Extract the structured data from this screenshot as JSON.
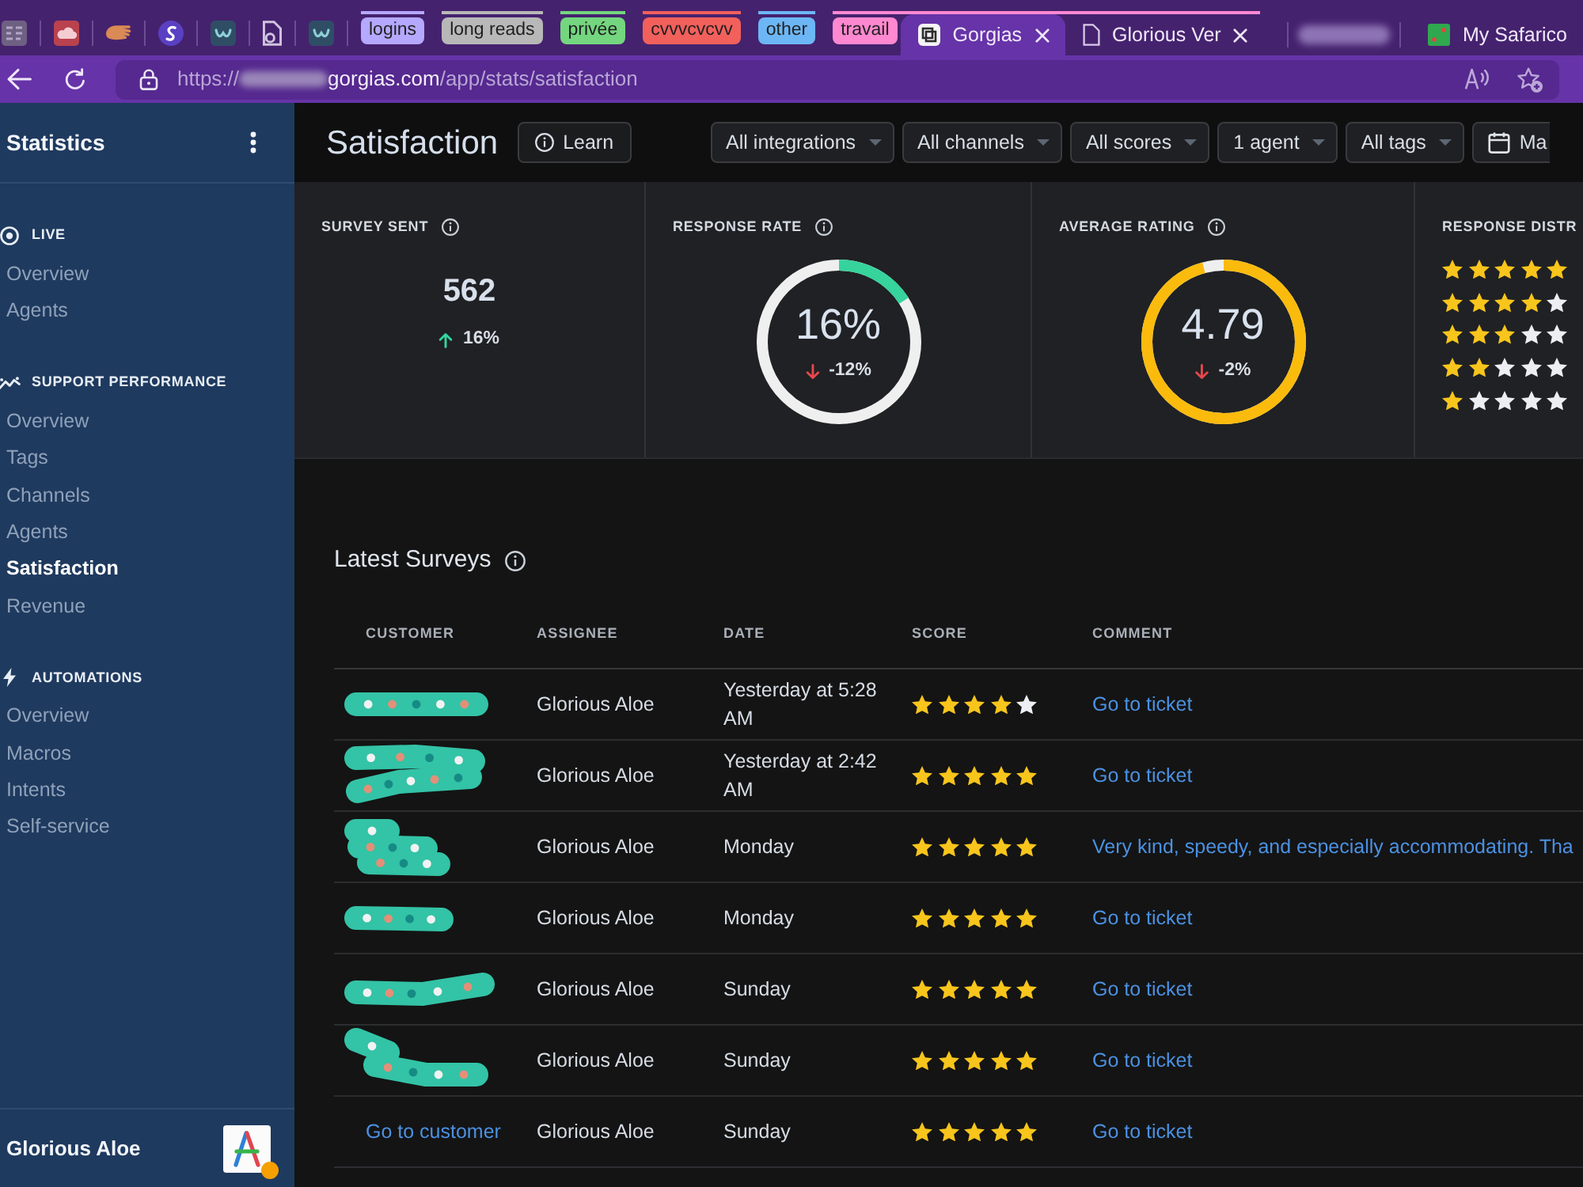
{
  "browser": {
    "pinned_tabs": [
      {
        "kind": "grid"
      },
      {
        "kind": "cloud"
      },
      {
        "kind": "hand"
      },
      {
        "kind": "swirl"
      },
      {
        "kind": "tile"
      },
      {
        "kind": "document"
      },
      {
        "kind": "tile"
      }
    ],
    "tab_groups": [
      {
        "label": "logins",
        "color": "#b5a8ff"
      },
      {
        "label": "long reads",
        "color": "#b8b8b8"
      },
      {
        "label": "privée",
        "color": "#74d67f"
      },
      {
        "label": "cvvvcvcvv",
        "color": "#f2605c"
      },
      {
        "label": "other",
        "color": "#6db6f5"
      },
      {
        "label": "travail",
        "color": "#ff88d1",
        "tabs": [
          {
            "kind": "framed",
            "title": "Gorgias",
            "selected": true,
            "closable": true
          },
          {
            "kind": "document",
            "title": "Glorious Ver",
            "selected": false,
            "closable": true
          }
        ]
      }
    ],
    "tabs": [
      {
        "kind": "redacted",
        "selected": false
      },
      {
        "kind": "tile",
        "title": "My Safarico",
        "selected": false,
        "closable": false
      }
    ],
    "address": [
      {
        "kind": "dim",
        "text": "https://"
      },
      {
        "kind": "blur"
      },
      {
        "kind": "bright",
        "text": "gorgias.com"
      },
      {
        "kind": "dim",
        "text": "/app/stats/satisfaction"
      }
    ]
  },
  "sidebar": {
    "title": "Statistics",
    "sections": [
      {
        "kind": "live",
        "label": "LIVE",
        "items": [
          {
            "label": "Overview",
            "selected": false
          },
          {
            "label": "Agents",
            "selected": false
          }
        ]
      },
      {
        "kind": "performance",
        "label": "SUPPORT PERFORMANCE",
        "items": [
          {
            "label": "Overview",
            "selected": false
          },
          {
            "label": "Tags",
            "selected": false
          },
          {
            "label": "Channels",
            "selected": false
          },
          {
            "label": "Agents",
            "selected": false
          },
          {
            "label": "Satisfaction",
            "selected": true
          },
          {
            "label": "Revenue",
            "selected": false
          }
        ]
      },
      {
        "kind": "automations",
        "label": "AUTOMATIONS",
        "items": [
          {
            "label": "Overview",
            "selected": false
          },
          {
            "label": "Macros",
            "selected": false
          },
          {
            "label": "Intents",
            "selected": false
          },
          {
            "label": "Self-service",
            "selected": false
          }
        ]
      }
    ],
    "user": {
      "name": "Glorious Aloe",
      "away": true
    }
  },
  "header": {
    "title": "Satisfaction",
    "learn": "Learn",
    "filters": [
      {
        "kind": "dropdown",
        "label": "All integrations"
      },
      {
        "kind": "dropdown",
        "label": "All channels"
      },
      {
        "kind": "dropdown",
        "label": "All scores"
      },
      {
        "kind": "dropdown",
        "label": "1 agent"
      },
      {
        "kind": "dropdown",
        "label": "All tags"
      },
      {
        "kind": "date",
        "label": "Ma"
      }
    ]
  },
  "stats": [
    {
      "kind": "number",
      "title": "SURVEY SENT",
      "info_icon": true,
      "value": "562",
      "rising": true,
      "delta": "16%"
    },
    {
      "kind": "ring",
      "title": "RESPONSE RATE",
      "info_icon": true,
      "value": "16%",
      "level": 0.16,
      "color": "#36d39c",
      "rising": false,
      "delta": "-12%"
    },
    {
      "kind": "ring",
      "title": "AVERAGE RATING",
      "info_icon": true,
      "value": "4.79",
      "level": 0.958,
      "color": "#fbbb0c",
      "rising": false,
      "delta": "-2%"
    },
    {
      "kind": "distribution",
      "title": "RESPONSE DISTR",
      "info_icon": false,
      "rows": [
        {
          "stars": 5
        },
        {
          "stars": 4
        },
        {
          "stars": 3
        },
        {
          "stars": 2
        },
        {
          "stars": 1
        }
      ]
    }
  ],
  "surveys": {
    "title": "Latest Surveys",
    "info_icon": true,
    "columns": [
      "CUSTOMER",
      "ASSIGNEE",
      "DATE",
      "SCORE",
      "COMMENT"
    ],
    "rows": [
      {
        "customer": {
          "kind": "scribble"
        },
        "assignee": "Glorious Aloe",
        "date": "Yesterday at 5:28 AM",
        "stars": 4,
        "comment": "Go to ticket"
      },
      {
        "customer": {
          "kind": "scribble"
        },
        "assignee": "Glorious Aloe",
        "date": "Yesterday at 2:42 AM",
        "stars": 5,
        "comment": "Go to ticket"
      },
      {
        "customer": {
          "kind": "scribble"
        },
        "assignee": "Glorious Aloe",
        "date": "Monday",
        "stars": 5,
        "comment": "Very kind, speedy, and especially accommodating. Tha"
      },
      {
        "customer": {
          "kind": "scribble"
        },
        "assignee": "Glorious Aloe",
        "date": "Monday",
        "stars": 5,
        "comment": "Go to ticket"
      },
      {
        "customer": {
          "kind": "scribble"
        },
        "assignee": "Glorious Aloe",
        "date": "Sunday",
        "stars": 5,
        "comment": "Go to ticket"
      },
      {
        "customer": {
          "kind": "scribble"
        },
        "assignee": "Glorious Aloe",
        "date": "Sunday",
        "stars": 5,
        "comment": "Go to ticket"
      },
      {
        "customer": {
          "kind": "link",
          "text": "Go to customer"
        },
        "assignee": "Glorious Aloe",
        "date": "Sunday",
        "stars": 5,
        "comment": "Go to ticket"
      }
    ]
  }
}
